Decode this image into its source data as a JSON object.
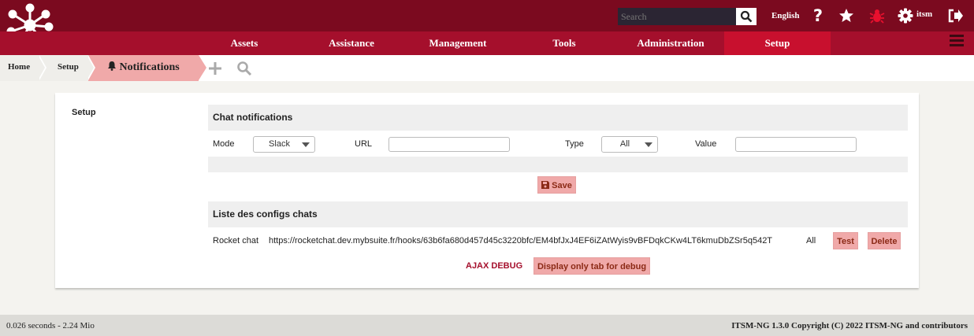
{
  "header": {
    "search_placeholder": "Search",
    "language": "English",
    "username": "itsm"
  },
  "menu": {
    "items": [
      "Assets",
      "Assistance",
      "Management",
      "Tools",
      "Administration",
      "Setup"
    ],
    "active": "Setup"
  },
  "breadcrumb": {
    "home": "Home",
    "setup": "Setup",
    "current": "Notifications"
  },
  "sidebar": {
    "label": "Setup"
  },
  "chat_notifications": {
    "title": "Chat notifications",
    "mode_label": "Mode",
    "mode_value": "Slack",
    "url_label": "URL",
    "url_value": "",
    "type_label": "Type",
    "type_value": "All",
    "value_label": "Value",
    "value_value": "",
    "save_label": "Save"
  },
  "configs_list": {
    "title": "Liste des configs chats",
    "rows": [
      {
        "name": "Rocket chat",
        "url": "https://rocketchat.dev.mybsuite.fr/hooks/63b6fa680d457d45c3220bfc/EM4bfJxJ4EF6iZAtWyis9vBFDqkCKw4LT6kmuDbZSr5q542T",
        "type": "All",
        "test_label": "Test",
        "delete_label": "Delete"
      }
    ]
  },
  "debug": {
    "ajax_label": "AJAX DEBUG",
    "display_only_label": "Display only tab for debug"
  },
  "footer": {
    "timing": "0.026 seconds - 2.24 Mio",
    "copyright": "ITSM-NG 1.3.0 Copyright (C) 2022 ITSM-NG and contributors"
  },
  "colors": {
    "header_bg": "#7b0a1f",
    "menu_bg": "#a50f2c",
    "active_menu_bg": "#c8102e",
    "button_pink": "#f0a9a9"
  }
}
